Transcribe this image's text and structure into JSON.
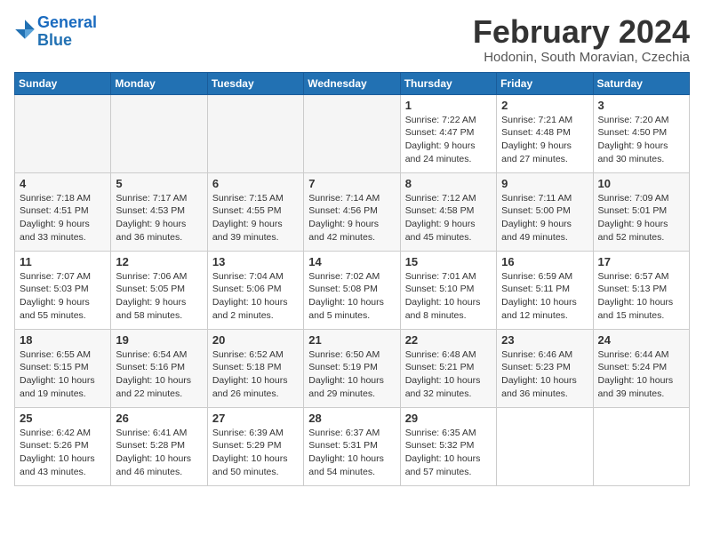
{
  "header": {
    "logo_line1": "General",
    "logo_line2": "Blue",
    "month": "February 2024",
    "location": "Hodonin, South Moravian, Czechia"
  },
  "weekdays": [
    "Sunday",
    "Monday",
    "Tuesday",
    "Wednesday",
    "Thursday",
    "Friday",
    "Saturday"
  ],
  "weeks": [
    {
      "row_class": "row1",
      "days": [
        {
          "num": "",
          "info": "",
          "empty": true
        },
        {
          "num": "",
          "info": "",
          "empty": true
        },
        {
          "num": "",
          "info": "",
          "empty": true
        },
        {
          "num": "",
          "info": "",
          "empty": true
        },
        {
          "num": "1",
          "info": "Sunrise: 7:22 AM\nSunset: 4:47 PM\nDaylight: 9 hours\nand 24 minutes."
        },
        {
          "num": "2",
          "info": "Sunrise: 7:21 AM\nSunset: 4:48 PM\nDaylight: 9 hours\nand 27 minutes."
        },
        {
          "num": "3",
          "info": "Sunrise: 7:20 AM\nSunset: 4:50 PM\nDaylight: 9 hours\nand 30 minutes."
        }
      ]
    },
    {
      "row_class": "row2",
      "days": [
        {
          "num": "4",
          "info": "Sunrise: 7:18 AM\nSunset: 4:51 PM\nDaylight: 9 hours\nand 33 minutes."
        },
        {
          "num": "5",
          "info": "Sunrise: 7:17 AM\nSunset: 4:53 PM\nDaylight: 9 hours\nand 36 minutes."
        },
        {
          "num": "6",
          "info": "Sunrise: 7:15 AM\nSunset: 4:55 PM\nDaylight: 9 hours\nand 39 minutes."
        },
        {
          "num": "7",
          "info": "Sunrise: 7:14 AM\nSunset: 4:56 PM\nDaylight: 9 hours\nand 42 minutes."
        },
        {
          "num": "8",
          "info": "Sunrise: 7:12 AM\nSunset: 4:58 PM\nDaylight: 9 hours\nand 45 minutes."
        },
        {
          "num": "9",
          "info": "Sunrise: 7:11 AM\nSunset: 5:00 PM\nDaylight: 9 hours\nand 49 minutes."
        },
        {
          "num": "10",
          "info": "Sunrise: 7:09 AM\nSunset: 5:01 PM\nDaylight: 9 hours\nand 52 minutes."
        }
      ]
    },
    {
      "row_class": "row3",
      "days": [
        {
          "num": "11",
          "info": "Sunrise: 7:07 AM\nSunset: 5:03 PM\nDaylight: 9 hours\nand 55 minutes."
        },
        {
          "num": "12",
          "info": "Sunrise: 7:06 AM\nSunset: 5:05 PM\nDaylight: 9 hours\nand 58 minutes."
        },
        {
          "num": "13",
          "info": "Sunrise: 7:04 AM\nSunset: 5:06 PM\nDaylight: 10 hours\nand 2 minutes."
        },
        {
          "num": "14",
          "info": "Sunrise: 7:02 AM\nSunset: 5:08 PM\nDaylight: 10 hours\nand 5 minutes."
        },
        {
          "num": "15",
          "info": "Sunrise: 7:01 AM\nSunset: 5:10 PM\nDaylight: 10 hours\nand 8 minutes."
        },
        {
          "num": "16",
          "info": "Sunrise: 6:59 AM\nSunset: 5:11 PM\nDaylight: 10 hours\nand 12 minutes."
        },
        {
          "num": "17",
          "info": "Sunrise: 6:57 AM\nSunset: 5:13 PM\nDaylight: 10 hours\nand 15 minutes."
        }
      ]
    },
    {
      "row_class": "row4",
      "days": [
        {
          "num": "18",
          "info": "Sunrise: 6:55 AM\nSunset: 5:15 PM\nDaylight: 10 hours\nand 19 minutes."
        },
        {
          "num": "19",
          "info": "Sunrise: 6:54 AM\nSunset: 5:16 PM\nDaylight: 10 hours\nand 22 minutes."
        },
        {
          "num": "20",
          "info": "Sunrise: 6:52 AM\nSunset: 5:18 PM\nDaylight: 10 hours\nand 26 minutes."
        },
        {
          "num": "21",
          "info": "Sunrise: 6:50 AM\nSunset: 5:19 PM\nDaylight: 10 hours\nand 29 minutes."
        },
        {
          "num": "22",
          "info": "Sunrise: 6:48 AM\nSunset: 5:21 PM\nDaylight: 10 hours\nand 32 minutes."
        },
        {
          "num": "23",
          "info": "Sunrise: 6:46 AM\nSunset: 5:23 PM\nDaylight: 10 hours\nand 36 minutes."
        },
        {
          "num": "24",
          "info": "Sunrise: 6:44 AM\nSunset: 5:24 PM\nDaylight: 10 hours\nand 39 minutes."
        }
      ]
    },
    {
      "row_class": "row5",
      "days": [
        {
          "num": "25",
          "info": "Sunrise: 6:42 AM\nSunset: 5:26 PM\nDaylight: 10 hours\nand 43 minutes."
        },
        {
          "num": "26",
          "info": "Sunrise: 6:41 AM\nSunset: 5:28 PM\nDaylight: 10 hours\nand 46 minutes."
        },
        {
          "num": "27",
          "info": "Sunrise: 6:39 AM\nSunset: 5:29 PM\nDaylight: 10 hours\nand 50 minutes."
        },
        {
          "num": "28",
          "info": "Sunrise: 6:37 AM\nSunset: 5:31 PM\nDaylight: 10 hours\nand 54 minutes."
        },
        {
          "num": "29",
          "info": "Sunrise: 6:35 AM\nSunset: 5:32 PM\nDaylight: 10 hours\nand 57 minutes."
        },
        {
          "num": "",
          "info": "",
          "empty": true
        },
        {
          "num": "",
          "info": "",
          "empty": true
        }
      ]
    }
  ]
}
